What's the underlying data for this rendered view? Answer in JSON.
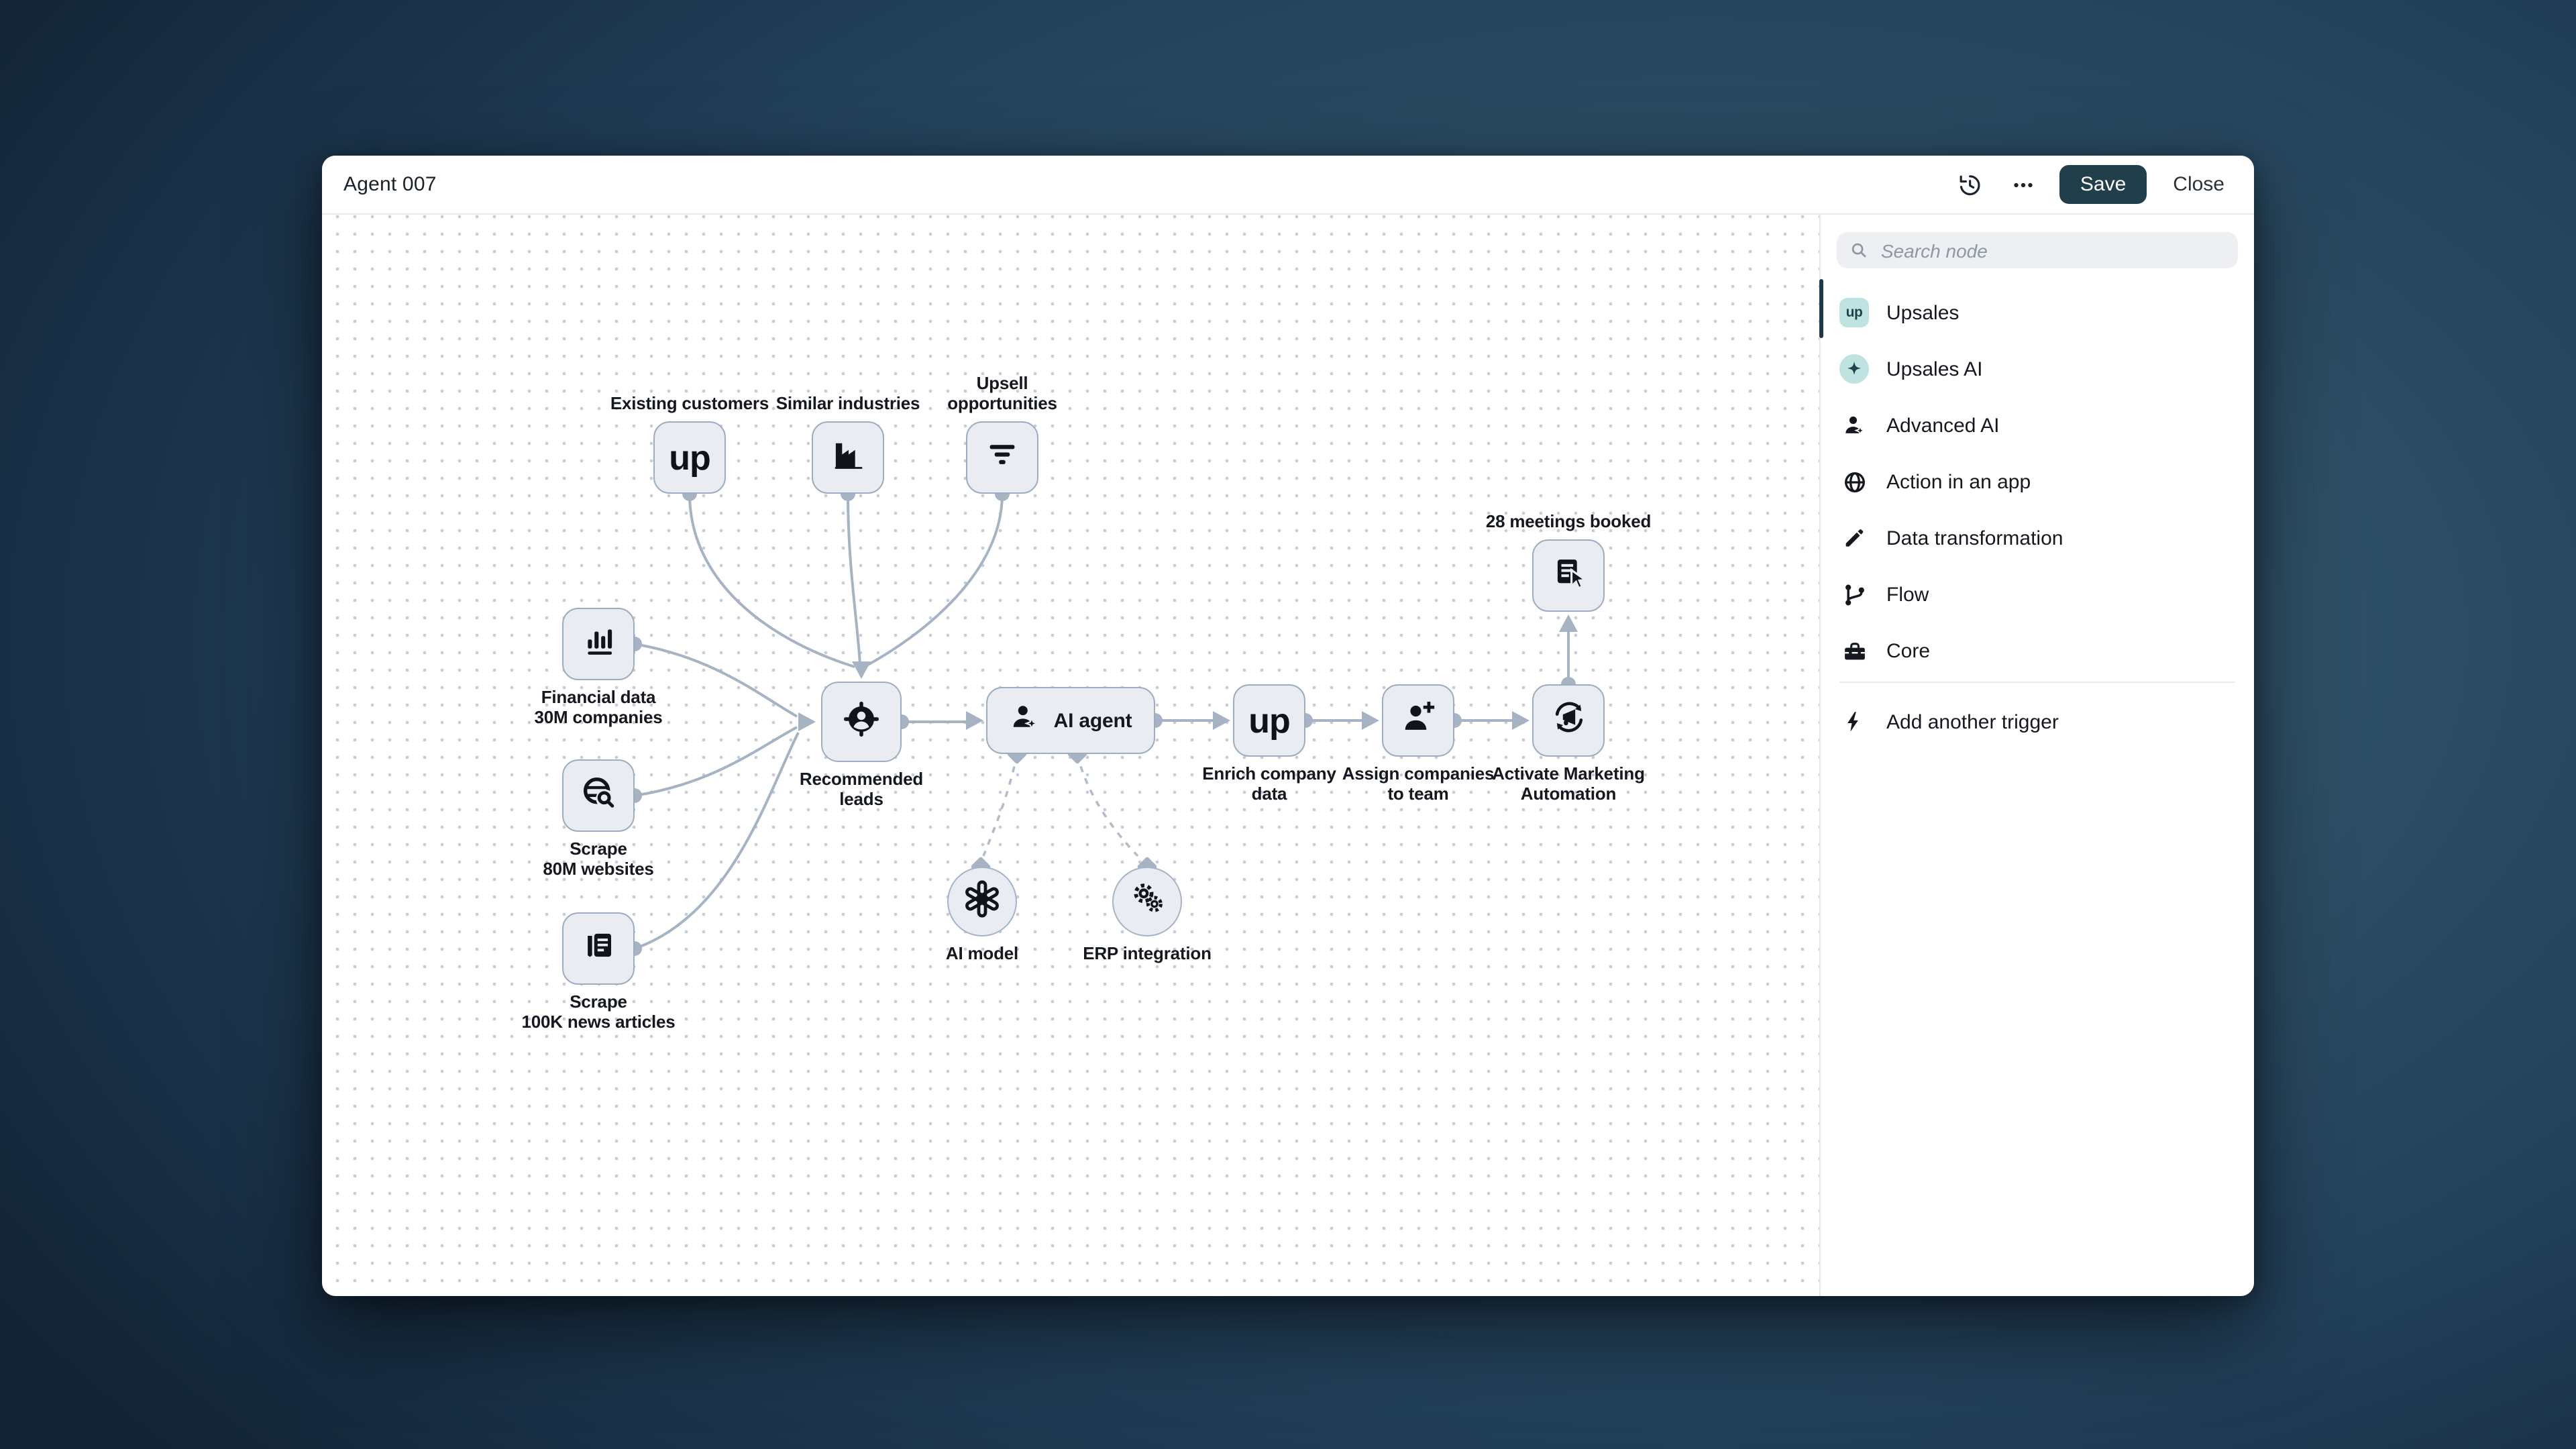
{
  "background": {
    "gradient_center": "#36596f",
    "gradient_edge": "#132434"
  },
  "window": {
    "title": "Agent 007",
    "header": {
      "save_label": "Save",
      "close_label": "Close",
      "save_bg": "#203f4b",
      "icons": [
        "history-icon",
        "ellipsis-icon"
      ]
    }
  },
  "canvas": {
    "logo_text": "up",
    "edge_color": "#a6b3c3",
    "node_fill": "#e9edf2",
    "node_border": "#9dadbf",
    "status_annotation": "28 meetings booked",
    "nodes": [
      {
        "id": "existing-customers",
        "label": "Existing customers",
        "icon": "upsales-up-logo",
        "shape": "square",
        "label_pos": "above"
      },
      {
        "id": "similar-industries",
        "label": "Similar industries",
        "icon": "factory-icon",
        "shape": "square",
        "label_pos": "above"
      },
      {
        "id": "upsell-opportunities",
        "label": "Upsell\nopportunities",
        "icon": "filter-icon",
        "shape": "square",
        "label_pos": "above"
      },
      {
        "id": "financial-data",
        "label": "Financial data\n30M companies",
        "icon": "bar-chart-icon",
        "shape": "square",
        "label_pos": "below"
      },
      {
        "id": "scrape-websites",
        "label": "Scrape\n80M websites",
        "icon": "web-search-icon",
        "shape": "square",
        "label_pos": "below"
      },
      {
        "id": "scrape-news",
        "label": "Scrape\n100K news articles",
        "icon": "news-icon",
        "shape": "square",
        "label_pos": "below"
      },
      {
        "id": "recommended-leads",
        "label": "Recommended\nleads",
        "icon": "lead-target-icon",
        "shape": "square",
        "label_pos": "below"
      },
      {
        "id": "ai-agent",
        "label": "AI agent",
        "icon": "person-sparkle-icon",
        "shape": "wide",
        "label_pos": "inside"
      },
      {
        "id": "enrich-company-data",
        "label": "Enrich company\ndata",
        "icon": "upsales-up-logo",
        "shape": "square",
        "label_pos": "below"
      },
      {
        "id": "assign-companies",
        "label": "Assign companies\nto team",
        "icon": "person-add-icon",
        "shape": "square",
        "label_pos": "below"
      },
      {
        "id": "activate-marketing",
        "label": "Activate Marketing\nAutomation",
        "icon": "megaphone-sync-icon",
        "shape": "square",
        "label_pos": "below"
      },
      {
        "id": "meetings-booked",
        "label": "28 meetings booked",
        "icon": "form-click-icon",
        "shape": "square",
        "label_pos": "above"
      },
      {
        "id": "ai-model",
        "label": "AI model",
        "icon": "openai-icon",
        "shape": "circle",
        "label_pos": "below"
      },
      {
        "id": "erp-integration",
        "label": "ERP integration",
        "icon": "gears-icon",
        "shape": "circle",
        "label_pos": "below"
      }
    ]
  },
  "sidebar": {
    "search": {
      "placeholder": "Search node",
      "icon": "search-icon"
    },
    "badge_color": "#bfe3e0",
    "items": [
      {
        "label": "Upsales",
        "icon": "upsales-badge",
        "active": true
      },
      {
        "label": "Upsales AI",
        "icon": "sparkle-icon",
        "active": false
      },
      {
        "label": "Advanced AI",
        "icon": "person-sparkle-icon",
        "active": false
      },
      {
        "label": "Action in an app",
        "icon": "globe-icon",
        "active": false
      },
      {
        "label": "Data transformation",
        "icon": "pencil-icon",
        "active": false
      },
      {
        "label": "Flow",
        "icon": "branch-icon",
        "active": false
      },
      {
        "label": "Core",
        "icon": "toolbox-icon",
        "active": false
      }
    ],
    "footer_item": {
      "label": "Add another trigger",
      "icon": "bolt-icon"
    }
  }
}
